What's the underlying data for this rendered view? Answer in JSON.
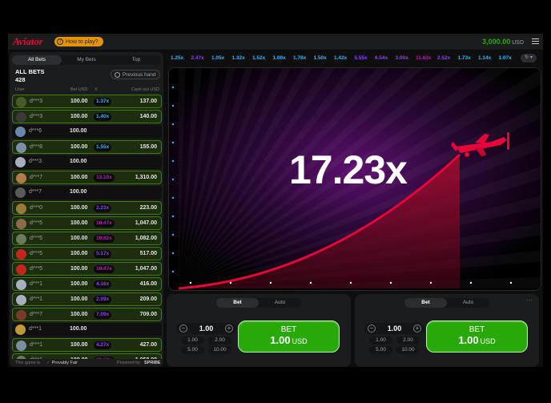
{
  "header": {
    "logo": "Aviator",
    "how_to_play": "How to play?",
    "balance": "3,000.00",
    "currency": "USD"
  },
  "left": {
    "tabs": [
      "All Bets",
      "My Bets",
      "Top"
    ],
    "title": "ALL BETS",
    "count": "428",
    "previous_hand": "Previous hand",
    "columns": {
      "user": "User",
      "bet": "Bet USD",
      "x": "X",
      "cashout": "Cash out USD"
    },
    "rows": [
      {
        "user": "d***3",
        "bet": "100.00",
        "mult": "1.37x",
        "cash": "137.00",
        "win": true,
        "avatar": "#4a5b2a",
        "mcolor": "#34b4ff"
      },
      {
        "user": "d***3",
        "bet": "100.00",
        "mult": "1.40x",
        "cash": "140.00",
        "win": true,
        "avatar": "#3a3a3a",
        "mcolor": "#34b4ff"
      },
      {
        "user": "d***6",
        "bet": "100.00",
        "mult": "",
        "cash": "",
        "win": false,
        "avatar": "#6b87a8",
        "mcolor": ""
      },
      {
        "user": "d***8",
        "bet": "100.00",
        "mult": "1.55x",
        "cash": "155.00",
        "win": true,
        "avatar": "#7a8ea5",
        "mcolor": "#34b4ff"
      },
      {
        "user": "d***3",
        "bet": "100.00",
        "mult": "",
        "cash": "",
        "win": false,
        "avatar": "#a7b0c0",
        "mcolor": ""
      },
      {
        "user": "d***7",
        "bet": "100.00",
        "mult": "13.10x",
        "cash": "1,310.00",
        "win": true,
        "avatar": "#b07a4a",
        "mcolor": "#c017b4"
      },
      {
        "user": "d***7",
        "bet": "100.00",
        "mult": "",
        "cash": "",
        "win": false,
        "avatar": "#5a5a5a",
        "mcolor": ""
      },
      {
        "user": "d***0",
        "bet": "100.00",
        "mult": "2.23x",
        "cash": "223.00",
        "win": true,
        "avatar": "#9a7a3a",
        "mcolor": "#913ef8"
      },
      {
        "user": "d***5",
        "bet": "100.00",
        "mult": "10.47x",
        "cash": "1,047.00",
        "win": true,
        "avatar": "#8c6a4a",
        "mcolor": "#c017b4"
      },
      {
        "user": "d***5",
        "bet": "100.00",
        "mult": "10.82x",
        "cash": "1,082.00",
        "win": true,
        "avatar": "#6a7a5a",
        "mcolor": "#c017b4"
      },
      {
        "user": "d***5",
        "bet": "100.00",
        "mult": "5.17x",
        "cash": "517.00",
        "win": true,
        "avatar": "#c4261e",
        "mcolor": "#913ef8"
      },
      {
        "user": "d***5",
        "bet": "100.00",
        "mult": "10.47x",
        "cash": "1,047.00",
        "win": true,
        "avatar": "#c4261e",
        "mcolor": "#c017b4"
      },
      {
        "user": "d***1",
        "bet": "100.00",
        "mult": "4.16x",
        "cash": "416.00",
        "win": true,
        "avatar": "#a7b0c0",
        "mcolor": "#913ef8"
      },
      {
        "user": "d***1",
        "bet": "100.00",
        "mult": "2.09x",
        "cash": "209.00",
        "win": true,
        "avatar": "#a7b0c0",
        "mcolor": "#913ef8"
      },
      {
        "user": "d***7",
        "bet": "100.00",
        "mult": "7.09x",
        "cash": "709.00",
        "win": true,
        "avatar": "#7a3a2a",
        "mcolor": "#913ef8"
      },
      {
        "user": "d***1",
        "bet": "100.00",
        "mult": "",
        "cash": "",
        "win": false,
        "avatar": "#c09a3a",
        "mcolor": ""
      },
      {
        "user": "d***1",
        "bet": "100.00",
        "mult": "4.27x",
        "cash": "427.00",
        "win": true,
        "avatar": "#7a8ea5",
        "mcolor": "#913ef8"
      },
      {
        "user": "d***1",
        "bet": "100.00",
        "mult": "10.58x",
        "cash": "1,058.00",
        "win": true,
        "avatar": "#6a7a5a",
        "mcolor": "#c017b4"
      }
    ],
    "footer": {
      "game_is": "This game is",
      "provably_fair": "Provably Fair",
      "powered_by": "Powered by",
      "brand": "SPRIBE"
    }
  },
  "history": [
    {
      "v": "1.25x",
      "c": "#34b4ff"
    },
    {
      "v": "2.47x",
      "c": "#913ef8"
    },
    {
      "v": "1.05x",
      "c": "#34b4ff"
    },
    {
      "v": "1.32x",
      "c": "#34b4ff"
    },
    {
      "v": "1.52x",
      "c": "#34b4ff"
    },
    {
      "v": "1.00x",
      "c": "#34b4ff"
    },
    {
      "v": "1.78x",
      "c": "#34b4ff"
    },
    {
      "v": "1.50x",
      "c": "#34b4ff"
    },
    {
      "v": "1.42x",
      "c": "#34b4ff"
    },
    {
      "v": "5.55x",
      "c": "#913ef8"
    },
    {
      "v": "6.54x",
      "c": "#913ef8"
    },
    {
      "v": "3.00x",
      "c": "#913ef8"
    },
    {
      "v": "11.63x",
      "c": "#c017b4"
    },
    {
      "v": "2.52x",
      "c": "#913ef8"
    },
    {
      "v": "1.73x",
      "c": "#34b4ff"
    },
    {
      "v": "1.14x",
      "c": "#34b4ff"
    },
    {
      "v": "1.07x",
      "c": "#34b4ff"
    }
  ],
  "game": {
    "multiplier": "17.23x",
    "plane_color": "#e50539"
  },
  "panels": [
    {
      "tabs": [
        "Bet",
        "Auto"
      ],
      "amount": "1.00",
      "quick": [
        "1.00",
        "2.00",
        "5.00",
        "10.00"
      ],
      "button": "BET",
      "button_amount": "1.00",
      "button_currency": "USD"
    },
    {
      "tabs": [
        "Bet",
        "Auto"
      ],
      "amount": "1.00",
      "quick": [
        "1.00",
        "2.00",
        "5.00",
        "10.00"
      ],
      "button": "BET",
      "button_amount": "1.00",
      "button_currency": "USD"
    }
  ]
}
